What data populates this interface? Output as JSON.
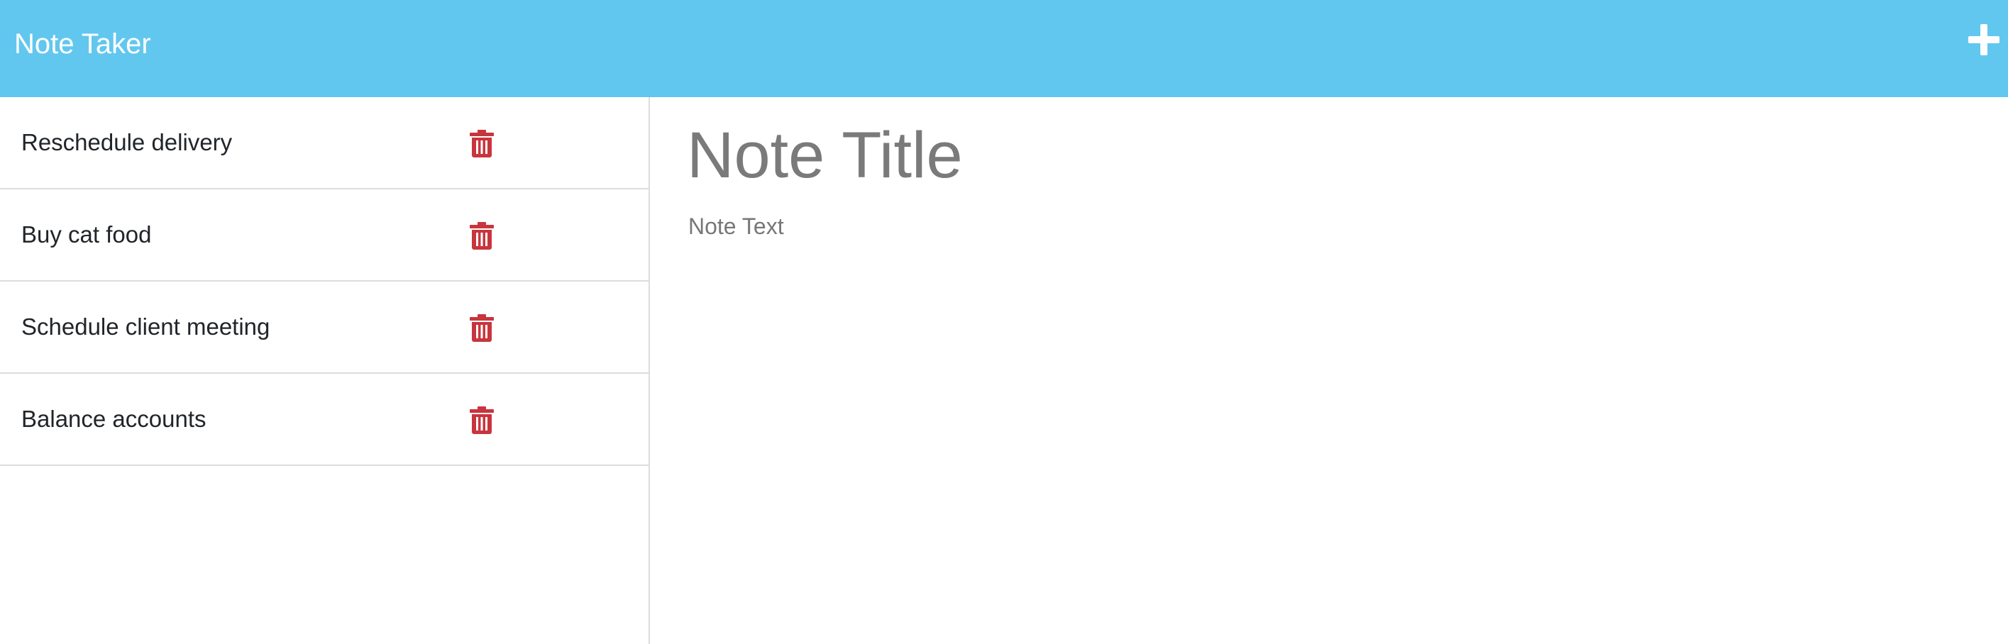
{
  "navbar": {
    "brand": "Note Taker",
    "new_note_icon": "plus-icon",
    "color": "#62c7ee"
  },
  "notes": [
    {
      "title": "Reschedule delivery",
      "delete_icon": "trash-icon"
    },
    {
      "title": "Buy cat food",
      "delete_icon": "trash-icon"
    },
    {
      "title": "Schedule client meeting",
      "delete_icon": "trash-icon"
    },
    {
      "title": "Balance accounts",
      "delete_icon": "trash-icon"
    }
  ],
  "editor": {
    "title_placeholder": "Note Title",
    "text_placeholder": "Note Text",
    "title_value": "",
    "text_value": ""
  },
  "colors": {
    "delete": "#c8353d",
    "placeholder": "#777777"
  }
}
